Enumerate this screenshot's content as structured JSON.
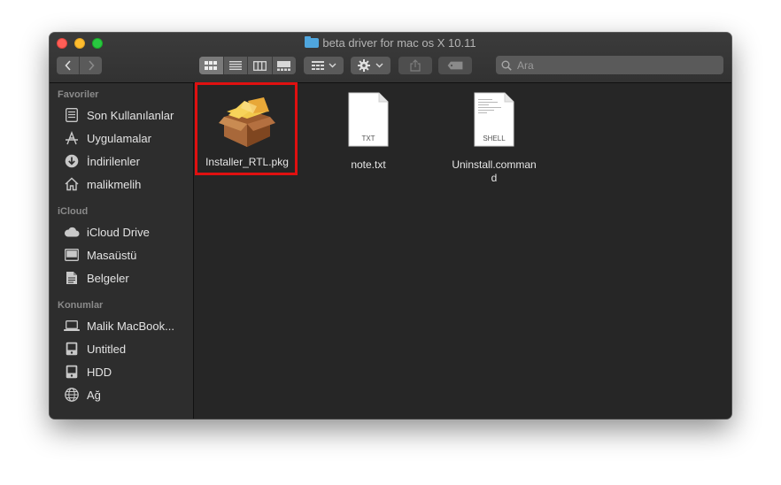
{
  "window": {
    "title": "beta driver for mac os X 10.11"
  },
  "toolbar": {
    "back_icon": "chevron-left-icon",
    "forward_icon": "chevron-right-icon",
    "view_modes": [
      "icon-view",
      "list-view",
      "column-view",
      "gallery-view"
    ],
    "active_view": "icon-view",
    "group_icon": "grid-icon",
    "action_icon": "gear-icon",
    "share_icon": "share-icon",
    "tag_icon": "tag-icon",
    "search_placeholder": "Ara"
  },
  "sidebar": {
    "sections": [
      {
        "header": "Favoriler",
        "items": [
          {
            "label": "Son Kullanılanlar",
            "icon": "recents-icon"
          },
          {
            "label": "Uygulamalar",
            "icon": "applications-icon"
          },
          {
            "label": "İndirilenler",
            "icon": "downloads-icon"
          },
          {
            "label": "malikmelih",
            "icon": "home-icon"
          }
        ]
      },
      {
        "header": "iCloud",
        "items": [
          {
            "label": "iCloud Drive",
            "icon": "cloud-icon"
          },
          {
            "label": "Masaüstü",
            "icon": "desktop-icon"
          },
          {
            "label": "Belgeler",
            "icon": "documents-icon"
          }
        ]
      },
      {
        "header": "Konumlar",
        "items": [
          {
            "label": "Malik MacBook...",
            "icon": "laptop-icon"
          },
          {
            "label": "Untitled",
            "icon": "disk-icon"
          },
          {
            "label": "HDD",
            "icon": "disk-icon"
          },
          {
            "label": "Ağ",
            "icon": "network-icon"
          }
        ]
      }
    ]
  },
  "files": [
    {
      "name": "Installer_RTL.pkg",
      "icon": "package-icon",
      "highlighted": true
    },
    {
      "name": "note.txt",
      "icon": "text-file-icon",
      "badge": "TXT"
    },
    {
      "name_line1": "Uninstall.comman",
      "name_line2": "d",
      "icon": "shell-file-icon",
      "badge": "SHELL"
    }
  ],
  "colors": {
    "highlight": "#e01010",
    "folder_blue": "#4fa6de"
  }
}
